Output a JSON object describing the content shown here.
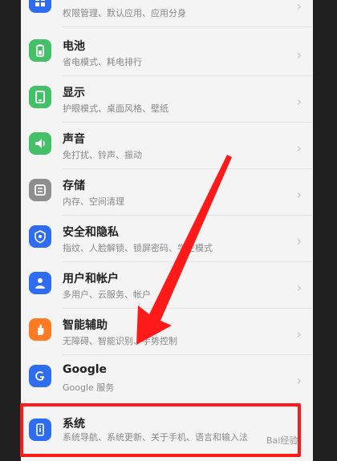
{
  "colors": {
    "green": "#44c068",
    "gray": "#8e8e8e",
    "blue": "#2f6df0",
    "orange": "#ff7b23",
    "highlight": "#ff1a1a"
  },
  "items": [
    {
      "title": "",
      "subtitle": "权限管理、默认应用、应用分身",
      "icon": "apps-icon"
    },
    {
      "title": "电池",
      "subtitle": "省电模式、耗电排行",
      "icon": "battery-icon"
    },
    {
      "title": "显示",
      "subtitle": "护眼模式、桌面风格、壁纸",
      "icon": "display-icon"
    },
    {
      "title": "声音",
      "subtitle": "免打扰、铃声、振动",
      "icon": "sound-icon"
    },
    {
      "title": "存储",
      "subtitle": "内存、空间清理",
      "icon": "storage-icon"
    },
    {
      "title": "安全和隐私",
      "subtitle": "指纹、人脸解锁、锁屏密码、学生模式",
      "icon": "security-icon"
    },
    {
      "title": "用户和帐户",
      "subtitle": "多用户、云服务、帐户",
      "icon": "user-icon"
    },
    {
      "title": "智能辅助",
      "subtitle": "无障碍、智能识别、手势控制",
      "icon": "assist-icon"
    },
    {
      "title": "Google",
      "subtitle": "Google 服务",
      "icon": "google-icon"
    },
    {
      "title": "系统",
      "subtitle": "系统导航、系统更新、关于手机、语言和输入法",
      "icon": "system-icon"
    }
  ],
  "watermark": "Bai经验"
}
